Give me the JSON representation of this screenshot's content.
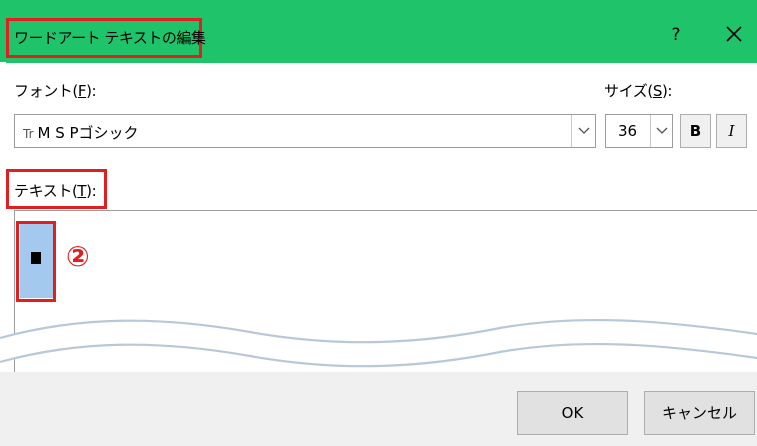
{
  "dialog": {
    "title": "ワードアート テキストの編集",
    "help_label": "?",
    "close_icon": "close-icon",
    "accent_color": "#1fc46a",
    "highlight_color": "#e02020"
  },
  "font": {
    "label_prefix": "フォント(",
    "label_key": "F",
    "label_suffix": "):",
    "value": "M S  Pゴシック",
    "type_icon": "Tr"
  },
  "size": {
    "label_prefix": "サイズ(",
    "label_key": "S",
    "label_suffix": "):",
    "value": "36"
  },
  "format": {
    "bold_label": "B",
    "italic_label": "I"
  },
  "text": {
    "label_prefix": "テキスト(",
    "label_key": "T",
    "label_suffix": "):",
    "content": "■"
  },
  "annotation": {
    "step_marker": "②"
  },
  "buttons": {
    "ok_label": "OK",
    "cancel_label": "キャンセル"
  }
}
